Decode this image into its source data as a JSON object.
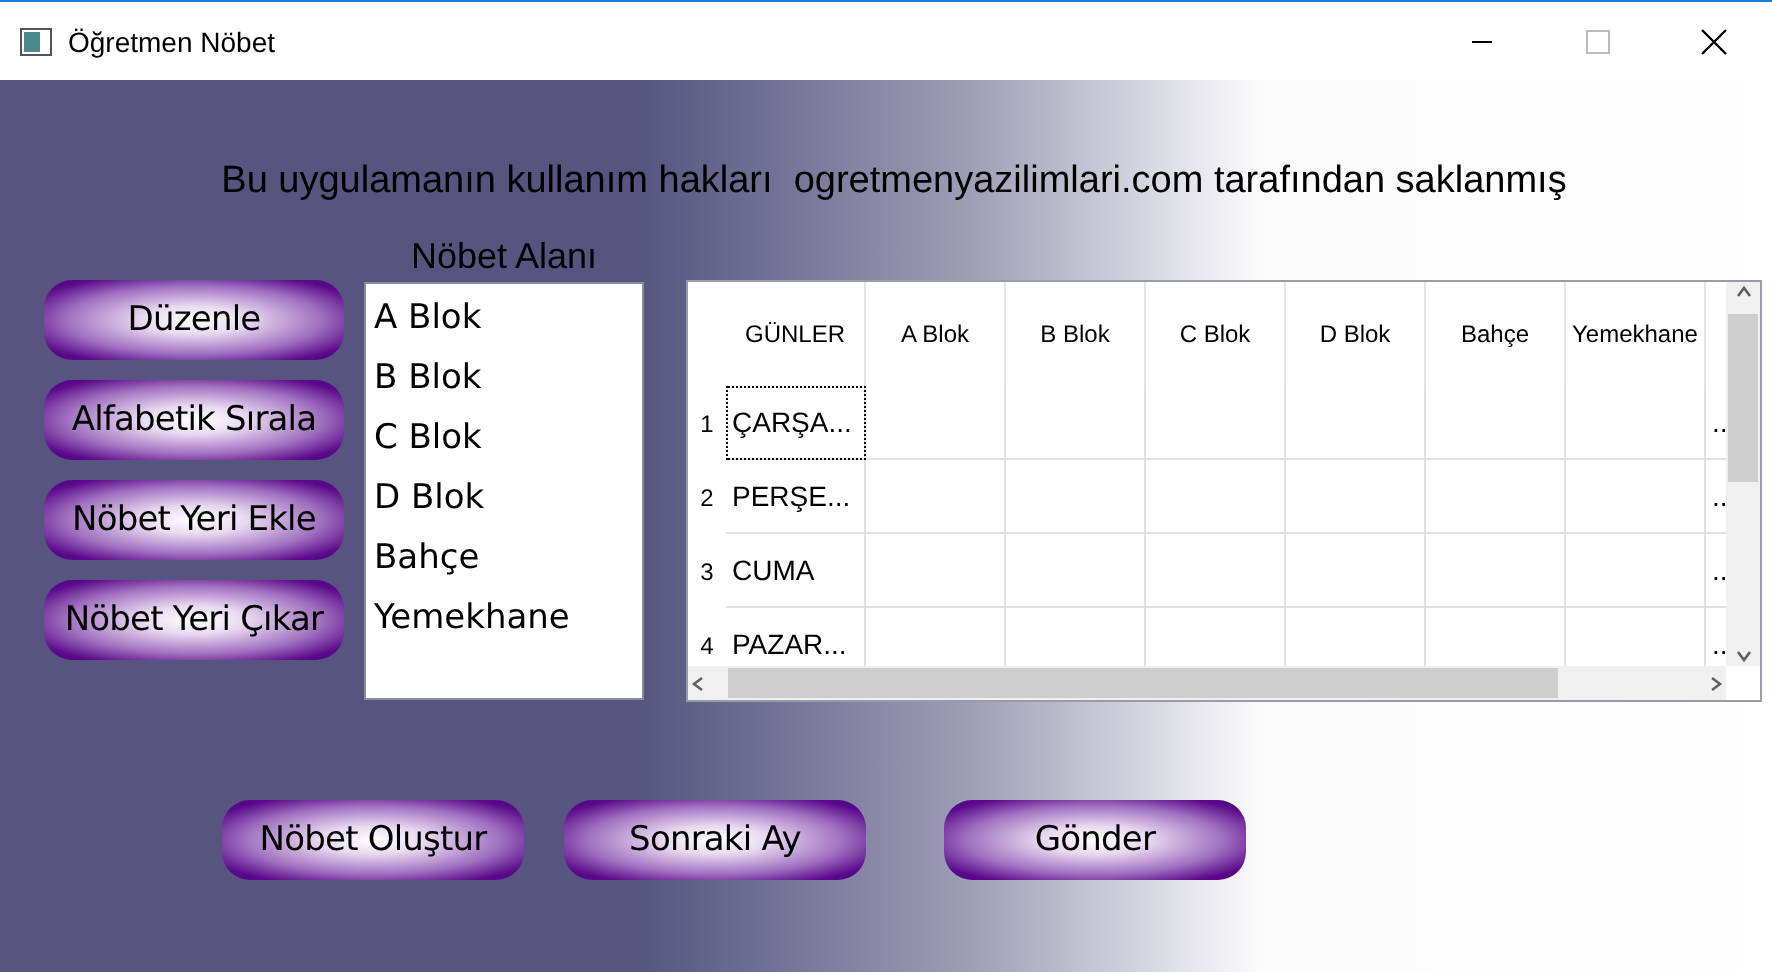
{
  "window": {
    "title": "Öğretmen Nöbet"
  },
  "notice": "Bu uygulamanın kullanım hakları  ogretmenyazilimlari.com tarafından saklanmış",
  "side_buttons": [
    "Düzenle",
    "Alfabetik Sırala",
    "Nöbet Yeri Ekle",
    "Nöbet Yeri Çıkar"
  ],
  "duty_areas": {
    "label": "Nöbet Alanı",
    "items": [
      "A Blok",
      "B Blok",
      "C Blok",
      "D Blok",
      "Bahçe",
      "Yemekhane"
    ]
  },
  "table": {
    "columns": [
      "GÜNLER",
      "A Blok",
      "B Blok",
      "C Blok",
      "D Blok",
      "Bahçe",
      "Yemekhane"
    ],
    "rows": [
      {
        "number": "1",
        "day": "ÇARŞA...",
        "last": "..",
        "focused": true
      },
      {
        "number": "2",
        "day": "PERŞE...",
        "last": "..",
        "focused": false
      },
      {
        "number": "3",
        "day": "CUMA",
        "last": "..",
        "focused": false
      },
      {
        "number": "4",
        "day": "PAZAR...",
        "last": "..",
        "focused": false
      }
    ]
  },
  "bottom_buttons": [
    "Nöbet Oluştur",
    "Sonraki Ay",
    "Gönder"
  ]
}
